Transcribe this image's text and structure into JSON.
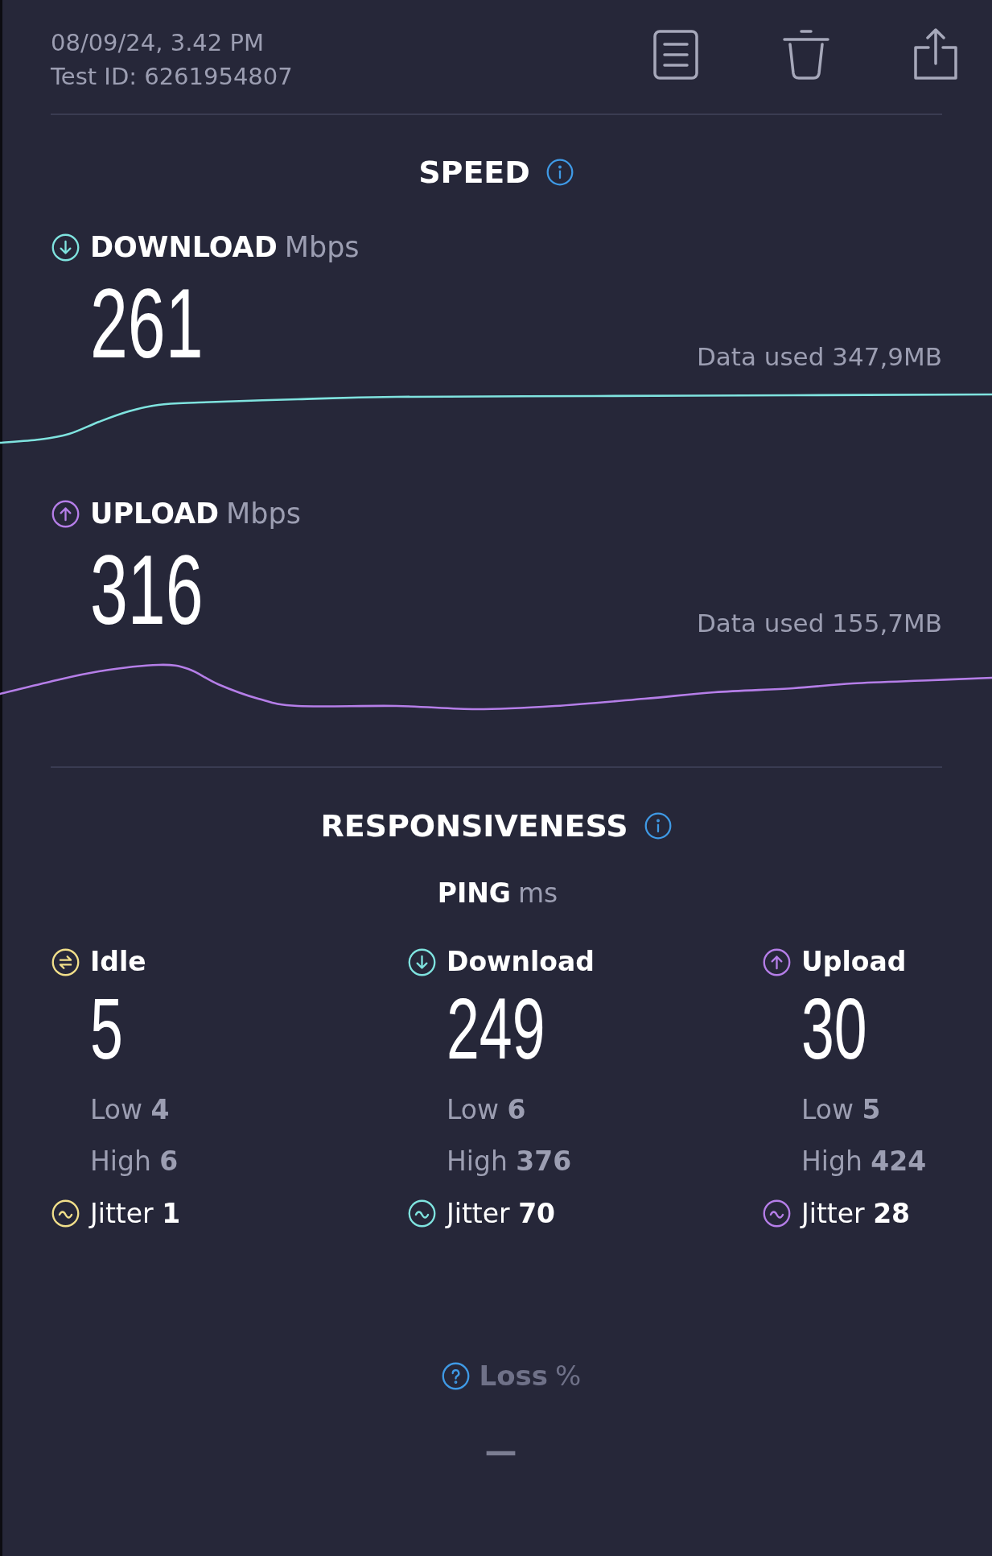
{
  "header": {
    "date_time": "08/09/24, 3.42 PM",
    "test_id": "Test ID: 6261954807"
  },
  "speed": {
    "title": "SPEED",
    "metrics": [
      {
        "kind": "download",
        "label": "DOWNLOAD",
        "unit": "Mbps",
        "value": "261",
        "data_used": "Data used 347,9MB"
      },
      {
        "kind": "upload",
        "label": "UPLOAD",
        "unit": "Mbps",
        "value": "316",
        "data_used": "Data used 155,7MB"
      }
    ]
  },
  "responsiveness": {
    "title": "RESPONSIVENESS",
    "ping": {
      "label": "PING",
      "unit": "ms"
    },
    "columns": [
      {
        "kind": "idle",
        "label": "Idle",
        "value": "5",
        "low": "Low **4**",
        "high": "High **6**",
        "jitter": "Jitter **1**"
      },
      {
        "kind": "download",
        "label": "Download",
        "value": "249",
        "low": "Low **6**",
        "high": "High **376**",
        "jitter": "Jitter **70**"
      },
      {
        "kind": "upload",
        "label": "Upload",
        "value": "30",
        "low": "Low **5**",
        "high": "High **424**",
        "jitter": "Jitter **28**"
      }
    ]
  },
  "loss": {
    "label": "Loss",
    "unit": "%",
    "value": "—"
  }
}
